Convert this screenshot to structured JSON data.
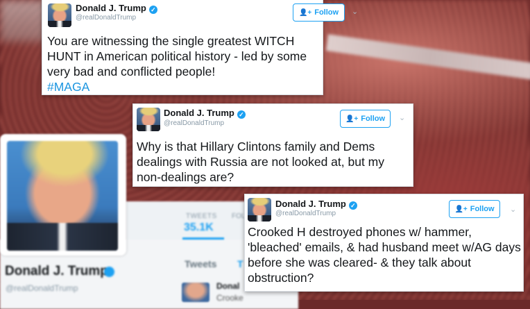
{
  "background": {
    "profile": {
      "name": "Donald J. Trump",
      "handle": "@realDonaldTrump",
      "tweets_label": "TWEETS",
      "tweets_count": "35.1K",
      "followers_label": "FOL",
      "tab_tweets": "Tweets",
      "tab_other": "T",
      "mini_name": "Donal",
      "mini_text": "Crooke"
    }
  },
  "tweets": [
    {
      "name": "Donald J. Trump",
      "handle": "@realDonaldTrump",
      "follow_label": "Follow",
      "text": "You are witnessing the single greatest WITCH HUNT in American political history - led by some very bad and conflicted people!",
      "hashtag": "#MAGA"
    },
    {
      "name": "Donald J. Trump",
      "handle": "@realDonaldTrump",
      "follow_label": "Follow",
      "text": "Why is that Hillary Clintons family and Dems dealings with Russia are not looked at, but my non-dealings are?"
    },
    {
      "name": "Donald J. Trump",
      "handle": "@realDonaldTrump",
      "follow_label": "Follow",
      "text": "Crooked H destroyed phones w/ hammer, 'bleached' emails, & had husband meet w/AG days before she was cleared- & they talk about obstruction?"
    }
  ],
  "icons": {
    "verified": "verified-check-icon",
    "follow": "add-person-icon",
    "caret": "chevron-down-icon"
  },
  "colors": {
    "twitter_blue": "#1da1f2",
    "hashtag_blue": "#1b95e0",
    "text": "#14171a",
    "muted": "#8899a6"
  }
}
